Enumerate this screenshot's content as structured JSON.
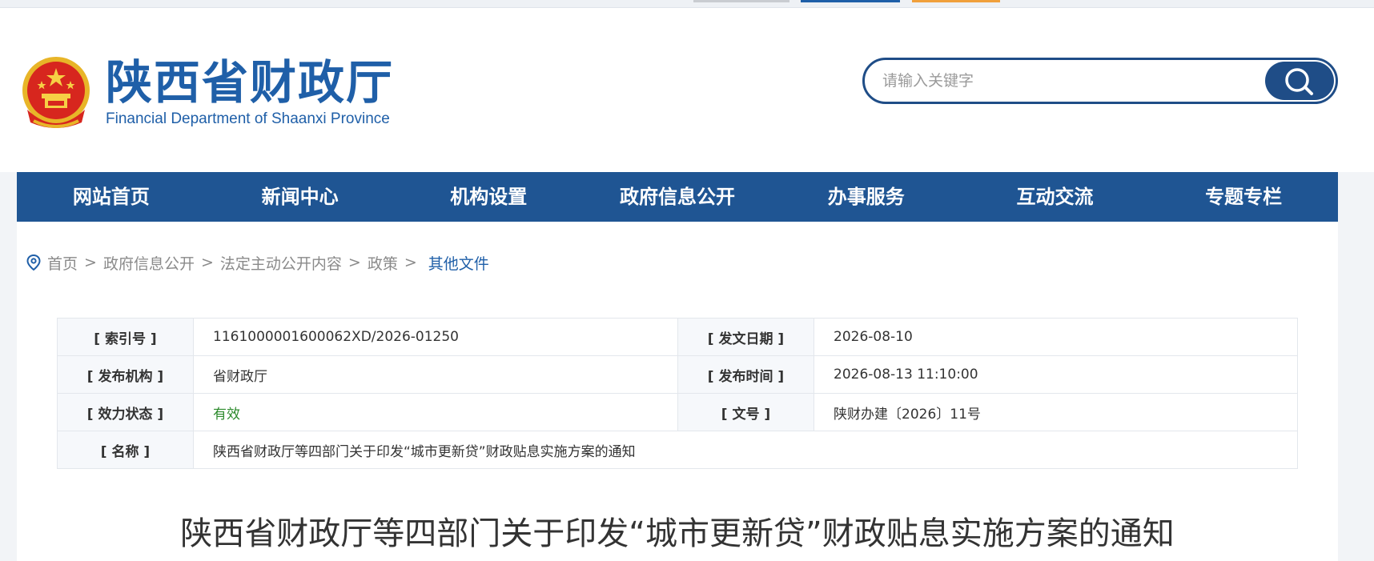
{
  "site": {
    "title": "陕西省财政厅",
    "subtitle": "Financial Department of Shaanxi Province"
  },
  "search": {
    "placeholder": "请输入关键字"
  },
  "nav": {
    "items": [
      {
        "label": "网站首页"
      },
      {
        "label": "新闻中心"
      },
      {
        "label": "机构设置"
      },
      {
        "label": "政府信息公开"
      },
      {
        "label": "办事服务"
      },
      {
        "label": "互动交流"
      },
      {
        "label": "专题专栏"
      }
    ]
  },
  "breadcrumb": {
    "items": [
      "首页",
      "政府信息公开",
      "法定主动公开内容",
      "政策"
    ],
    "separator": ">",
    "current": "其他文件"
  },
  "meta": {
    "index_label": "[ 索引号 ]",
    "index_value": "1161000001600062XD/2026-01250",
    "issue_date_label": "[ 发文日期 ]",
    "issue_date_value": "2026-08-10",
    "publisher_label": "[ 发布机构 ]",
    "publisher_value": "省财政厅",
    "publish_time_label": "[ 发布时间 ]",
    "publish_time_value": "2026-08-13 11:10:00",
    "status_label": "[ 效力状态 ]",
    "status_value": "有效",
    "doc_no_label": "[ 文号 ]",
    "doc_no_value": "陕财办建〔2026〕11号",
    "name_label": "[ 名称 ]",
    "name_value": "陕西省财政厅等四部门关于印发“城市更新贷”财政贴息实施方案的通知"
  },
  "document": {
    "title": "陕西省财政厅等四部门关于印发“城市更新贷”财政贴息实施方案的通知"
  },
  "colors": {
    "brand": "#1f5fa8",
    "nav_bg": "#1f5593",
    "status_green": "#2c8a2c"
  }
}
